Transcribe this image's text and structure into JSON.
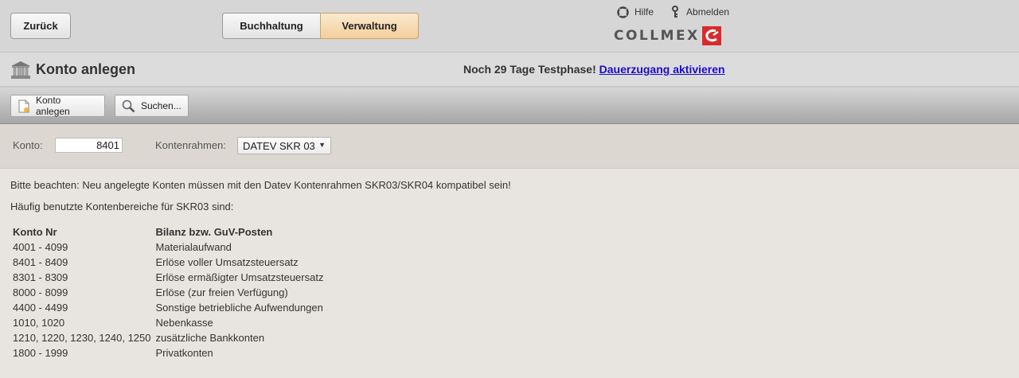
{
  "header": {
    "back_label": "Zurück",
    "tabs": [
      {
        "label": "Buchhaltung",
        "active": false
      },
      {
        "label": "Verwaltung",
        "active": true
      }
    ],
    "help_label": "Hilfe",
    "logout_label": "Abmelden",
    "logo_text": "COLLMEX",
    "accent_color": "#f3cf9b"
  },
  "titlebar": {
    "title": "Konto anlegen",
    "trial_text": "Noch 29 Tage Testphase!",
    "trial_link": "Dauerzugang aktivieren"
  },
  "toolbar": {
    "new_label": "Konto anlegen",
    "search_label": "Suchen..."
  },
  "filter": {
    "konto_label": "Konto:",
    "konto_value": "8401",
    "rahmen_label": "Kontenrahmen:",
    "rahmen_value": "DATEV SKR 03"
  },
  "content": {
    "note": "Bitte beachten: Neu angelegte Konten müssen mit den Datev Kontenrahmen SKR03/SKR04 kompatibel sein!",
    "subheading": "Häufig benutzte Kontenbereiche für SKR03 sind:",
    "table_headers": [
      "Konto Nr",
      "Bilanz bzw. GuV-Posten"
    ],
    "rows": [
      [
        "4001 - 4099",
        "Materialaufwand"
      ],
      [
        "8401 - 8409",
        "Erlöse voller Umsatzsteuersatz"
      ],
      [
        "8301 - 8309",
        "Erlöse ermäßigter Umsatzsteuersatz"
      ],
      [
        "8000 - 8099",
        "Erlöse (zur freien Verfügung)"
      ],
      [
        "4400 - 4499",
        "Sonstige betriebliche Aufwendungen"
      ],
      [
        "1010, 1020",
        "Nebenkasse"
      ],
      [
        "1210, 1220, 1230, 1240, 1250",
        "zusätzliche Bankkonten"
      ],
      [
        "1800 - 1999",
        "Privatkonten"
      ]
    ]
  }
}
